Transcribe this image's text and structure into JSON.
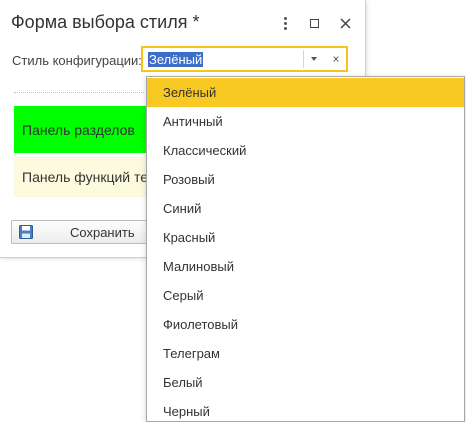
{
  "window": {
    "title": "Форма выбора стиля *"
  },
  "form": {
    "style_label": "Стиль конфигурации:",
    "style_value": "Зелёный",
    "clear_glyph": "×"
  },
  "panels": {
    "sections_label": "Панель разделов",
    "functions_label": "Панель функций тек"
  },
  "buttons": {
    "save_label": "Сохранить"
  },
  "dropdown": {
    "items": [
      "Зелёный",
      "Античный",
      "Классический",
      "Розовый",
      "Синий",
      "Красный",
      "Малиновый",
      "Серый",
      "Фиолетовый",
      "Телеграм",
      "Белый",
      "Черный"
    ],
    "selected": "Зелёный"
  },
  "colors": {
    "accent_yellow": "#f8c923",
    "selection_blue": "#3c6ec8",
    "sections_green": "#00ff00",
    "functions_cream": "#fdfbde"
  },
  "icons": [
    "more-icon",
    "maximize-icon",
    "close-icon",
    "dropdown-arrow-icon",
    "clear-icon",
    "save-icon"
  ]
}
